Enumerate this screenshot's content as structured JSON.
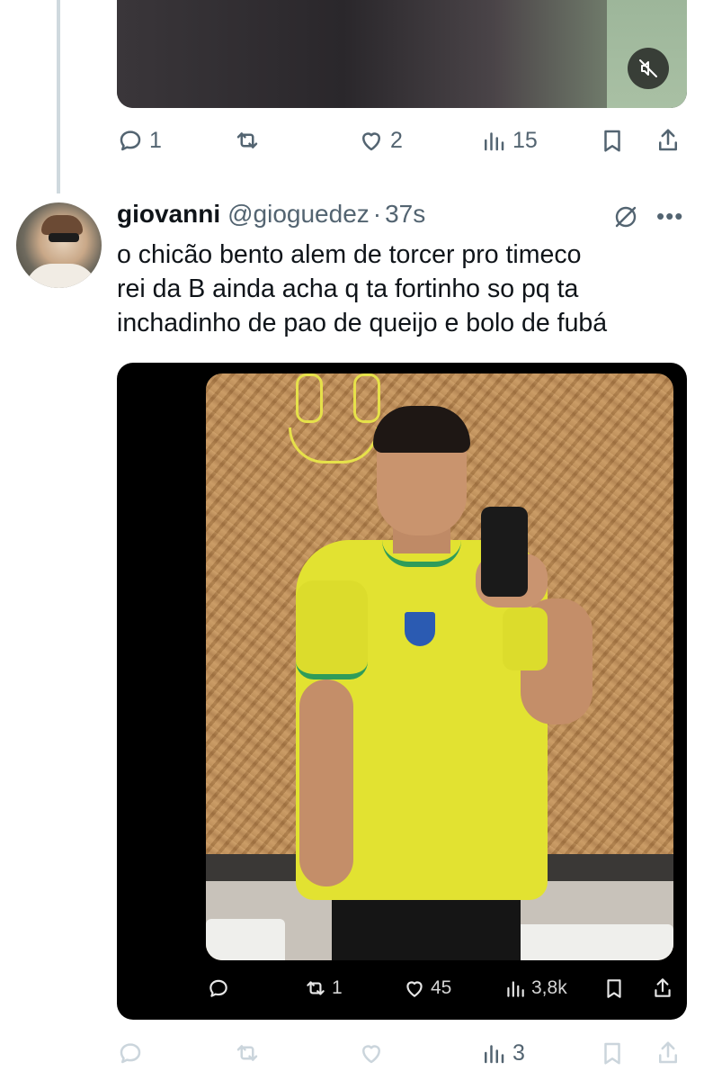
{
  "previous_tweet": {
    "actions": {
      "replies": "1",
      "retweets": "",
      "likes": "2",
      "views": "15"
    }
  },
  "tweet": {
    "display_name": "giovanni",
    "handle": "@gioguedez",
    "separator": "·",
    "time": "37s",
    "text_lines": [
      "o chicão bento alem de torcer pro timeco",
      "rei da B ainda acha q ta fortinho so pq ta",
      "inchadinho de pao de queijo e bolo de fubá"
    ],
    "embedded_actions": {
      "replies": "",
      "retweets": "1",
      "likes": "45",
      "views": "3,8k"
    },
    "actions": {
      "replies": "",
      "retweets": "",
      "likes": "",
      "views": "3"
    }
  },
  "colors": {
    "text_primary": "#0f1419",
    "text_secondary": "#536471",
    "thread_line": "#cfd9de"
  }
}
